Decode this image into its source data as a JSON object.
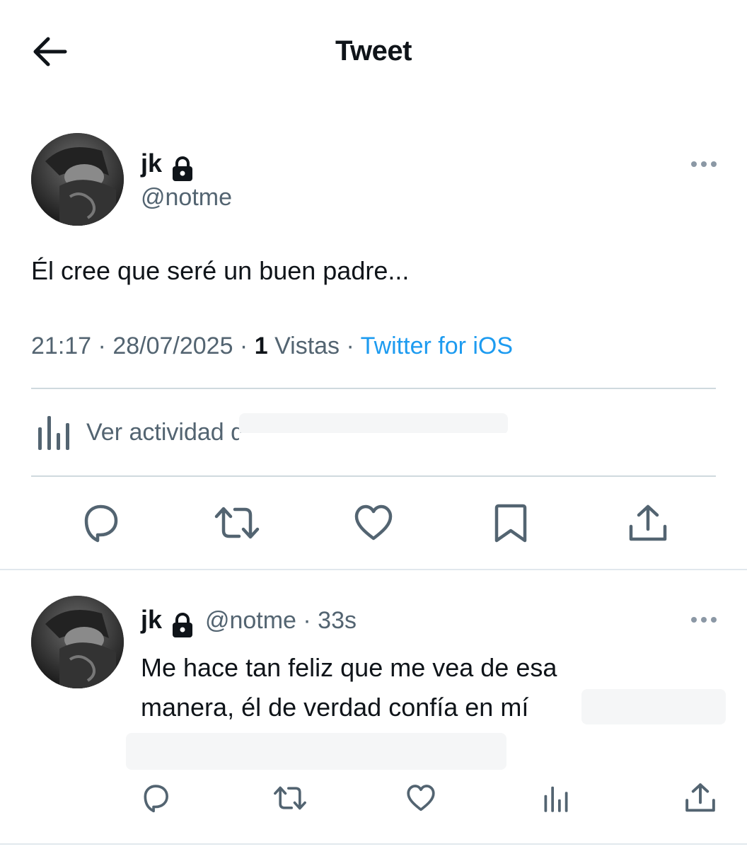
{
  "header": {
    "title": "Tweet",
    "back_icon": "arrow-left-icon"
  },
  "main_tweet": {
    "display_name": "jk",
    "handle": "@notme",
    "text": "Él cree que seré un buen padre...",
    "time": "21:17",
    "date": "28/07/2025",
    "views_count": "1",
    "views_label": "Vistas",
    "source": "Twitter for iOS",
    "activity_label": "Ver actividad de Tweet",
    "actions": [
      "reply-icon",
      "retweet-icon",
      "like-icon",
      "bookmark-icon",
      "share-icon"
    ]
  },
  "reply_tweet": {
    "display_name": "jk",
    "handle": "@notme",
    "age": "33s",
    "text_line1": "Me hace tan feliz que me vea de esa",
    "text_line2": "manera, él de verdad confía en mí",
    "actions": [
      "reply-icon",
      "retweet-icon",
      "like-icon",
      "views-icon",
      "share-icon"
    ]
  },
  "colors": {
    "link": "#1d9bf0",
    "secondary": "#536471",
    "primary": "#0f1419",
    "divider": "#cfd9de"
  },
  "separator": " · "
}
